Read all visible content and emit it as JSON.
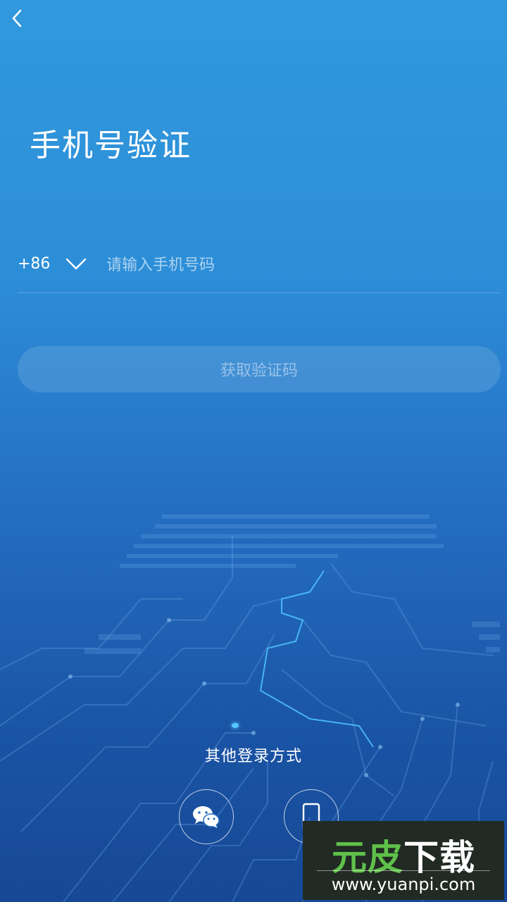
{
  "header": {
    "back_icon": "chevron-left-icon"
  },
  "page": {
    "title": "手机号验证"
  },
  "phone": {
    "country_code": "+86",
    "dropdown_icon": "chevron-down-icon",
    "placeholder": "请输入手机号码",
    "value": ""
  },
  "actions": {
    "get_code_label": "获取验证码"
  },
  "other_login": {
    "label": "其他登录方式",
    "options": [
      {
        "icon": "wechat-icon"
      },
      {
        "icon": "mobile-phone-icon"
      }
    ]
  },
  "watermark": {
    "brand_part1": "元皮",
    "brand_part2": "下载",
    "url": "www.yuanpi.com"
  },
  "colors": {
    "background_top": "#3199dd",
    "background_bottom": "#164896",
    "glow": "#54c7ff",
    "watermark_green": "#5fc14a"
  }
}
